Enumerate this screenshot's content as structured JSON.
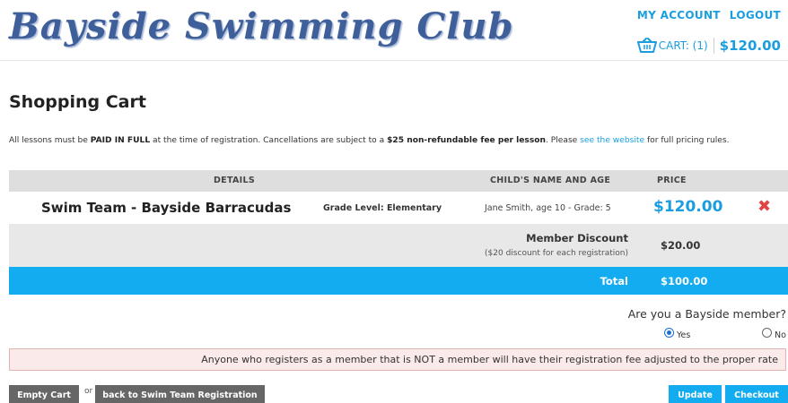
{
  "header": {
    "logo_text": "Bayside Swimming Club",
    "links": {
      "account": "MY ACCOUNT",
      "logout": "LOGOUT"
    },
    "cart": {
      "label": "CART: (1)",
      "total": "$120.00",
      "icon": "shopping-basket-icon"
    }
  },
  "page": {
    "title": "Shopping Cart",
    "notice": {
      "prefix": "All lessons must be ",
      "paid_in_full": "PAID IN FULL",
      "middle": " at the time of registration. Cancellations are subject to a ",
      "fee": "$25 non-refundable fee per lesson",
      "please": ". Please ",
      "link_text": "see the website",
      "suffix": " for full pricing rules."
    }
  },
  "table": {
    "headers": {
      "details": "DETAILS",
      "child": "CHILD'S NAME AND AGE",
      "price": "PRICE"
    },
    "items": [
      {
        "name": "Swim Team - Bayside Barracudas",
        "grade": "Grade Level: Elementary",
        "child": "Jane Smith, age 10 - Grade: 5",
        "price": "$120.00",
        "remove_icon": "close-x-icon"
      }
    ],
    "discount": {
      "label": "Member Discount",
      "note": "($20 discount for each registration)",
      "amount": "$20.00"
    },
    "total": {
      "label": "Total",
      "amount": "$100.00"
    }
  },
  "membership": {
    "question": "Are you a Bayside member?",
    "options": [
      {
        "label": "Yes",
        "selected": true
      },
      {
        "label": "No",
        "selected": false
      }
    ]
  },
  "warning": "Anyone who registers as a member that is NOT a member will have their registration fee adjusted to the proper rate",
  "actions": {
    "empty_cart": "Empty Cart",
    "or": "or",
    "back": "back to Swim Team Registration",
    "update": "Update",
    "checkout": "Checkout"
  },
  "colors": {
    "accent": "#1a9ee0",
    "total_bar": "#14acf0",
    "remove": "#e04545",
    "warning_bg": "#fbeaea"
  }
}
